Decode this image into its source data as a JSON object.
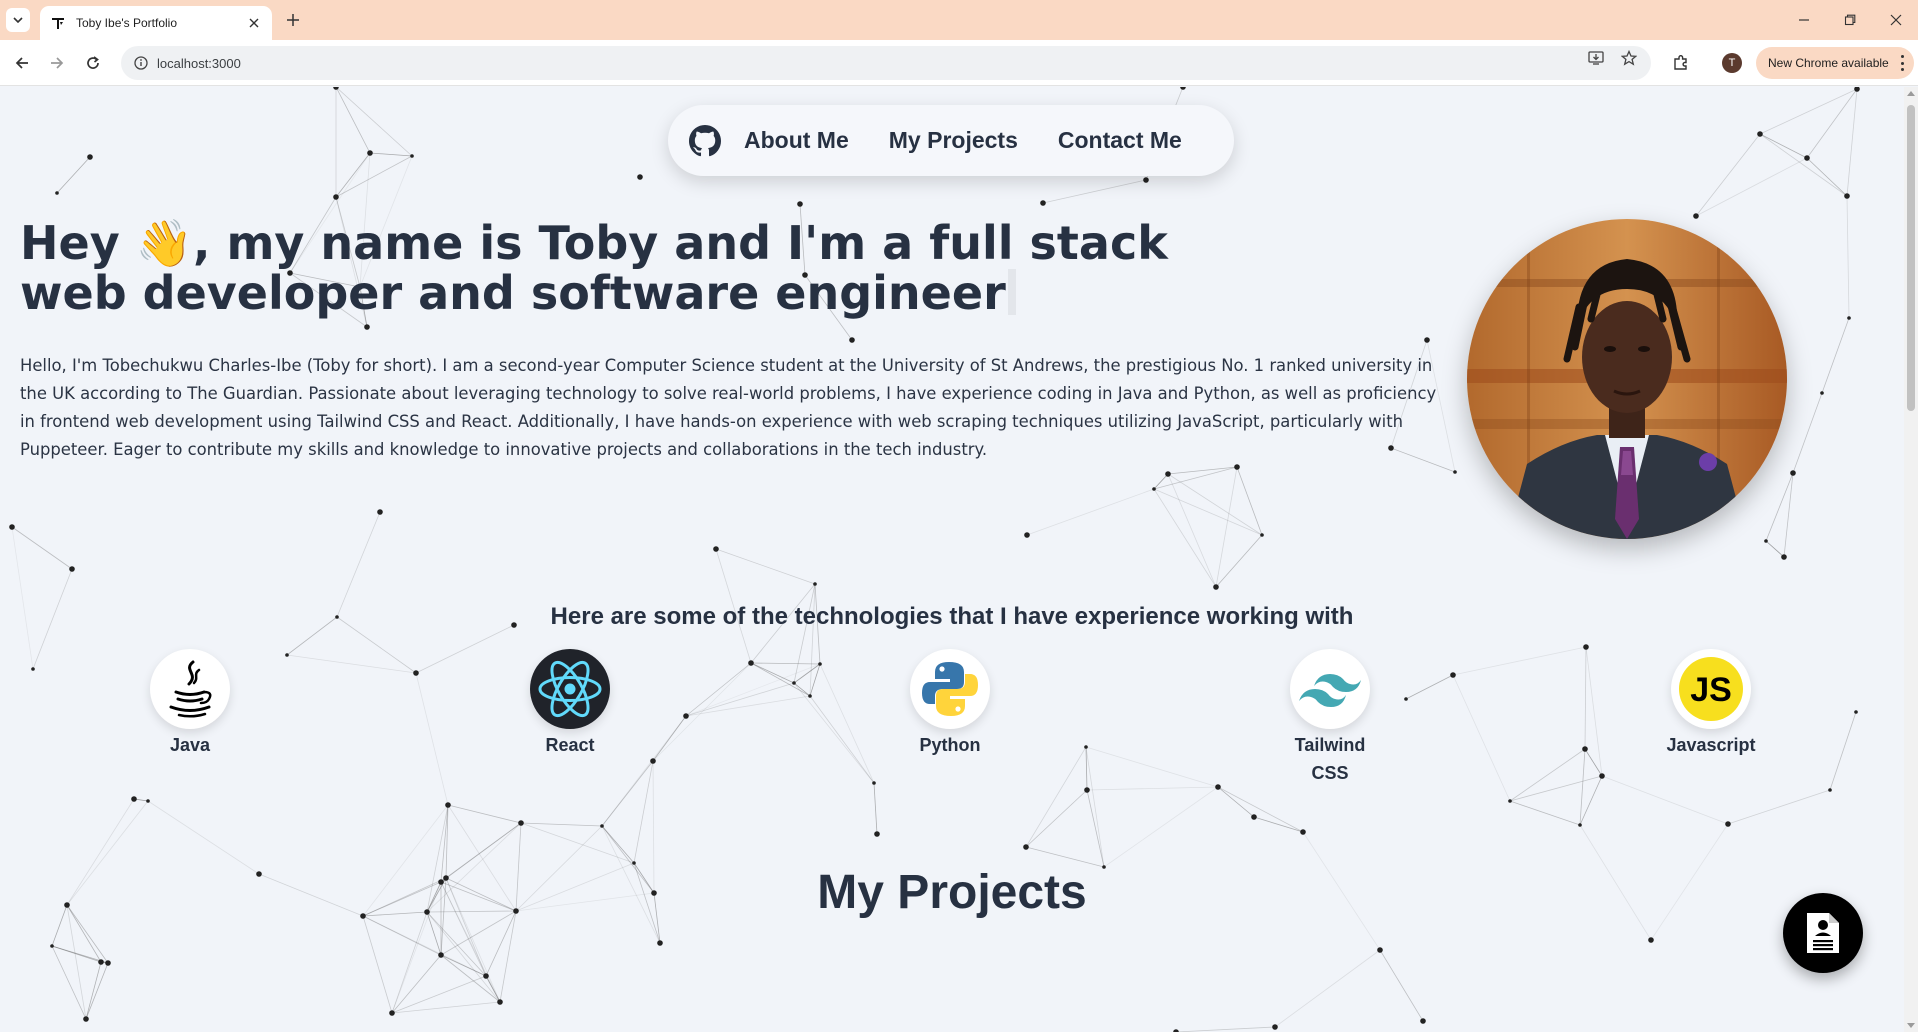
{
  "browser": {
    "tab_title": "Toby Ibe's Portfolio",
    "url": "localhost:3000",
    "profile_initial": "T",
    "update_label": "New Chrome available"
  },
  "nav": {
    "about": "About Me",
    "projects": "My Projects",
    "contact": "Contact Me"
  },
  "hero": {
    "title_before": "Hey ",
    "wave": "👋",
    "title_after": ", my name is Toby and I'm a full stack web developer and software engineer",
    "bio": "Hello, I'm Tobechukwu Charles-Ibe (Toby for short). I am a second-year Computer Science student at the University of St Andrews, the prestigious No. 1 ranked university in the UK according to The Guardian. Passionate about leveraging technology to solve real-world problems, I have experience coding in Java and Python, as well as proficiency in frontend web development using Tailwind CSS and React. Additionally, I have hands-on experience with web scraping techniques utilizing JavaScript, particularly with Puppeteer. Eager to contribute my skills and knowledge to innovative projects and collaborations in the tech industry."
  },
  "tech": {
    "heading": "Here are some of the technologies that I have experience working with",
    "items": [
      {
        "label": "Java",
        "icon": "java-icon"
      },
      {
        "label": "React",
        "icon": "react-icon"
      },
      {
        "label": "Python",
        "icon": "python-icon"
      },
      {
        "label": "Tailwind CSS",
        "icon": "tailwind-icon"
      },
      {
        "label": "Javascript",
        "icon": "javascript-icon"
      }
    ]
  },
  "projects": {
    "title": "My Projects"
  },
  "colors": {
    "text": "#273142",
    "background": "#f1f4f9",
    "chrome_tabbar": "#fad9c4",
    "react_bg": "#20232a",
    "react_accent": "#61dafb",
    "js_yellow": "#f7df1e",
    "tailwind": "#38bdf8"
  }
}
